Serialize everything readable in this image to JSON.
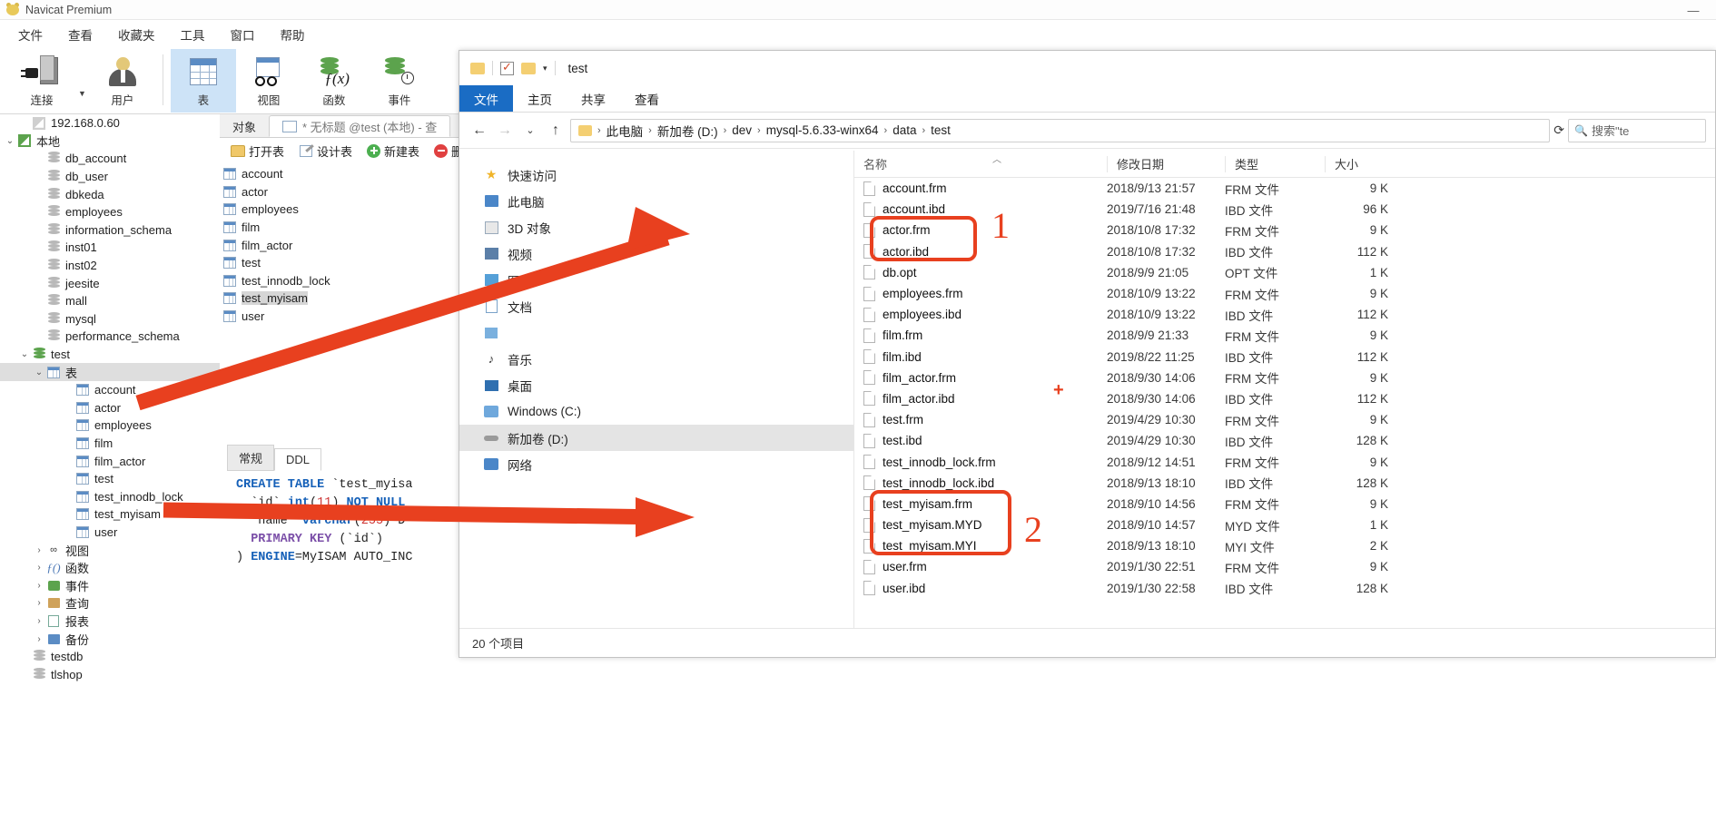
{
  "app": {
    "title": "Navicat Premium",
    "minimize_label": "—",
    "menu": [
      "文件",
      "查看",
      "收藏夹",
      "工具",
      "窗口",
      "帮助"
    ],
    "ribbon": [
      {
        "label": "连接",
        "icon": "connection-icon"
      },
      {
        "label": "用户",
        "icon": "user-icon"
      },
      {
        "label": "表",
        "icon": "table-icon",
        "active": true
      },
      {
        "label": "视图",
        "icon": "view-icon"
      },
      {
        "label": "函数",
        "icon": "function-icon"
      },
      {
        "label": "事件",
        "icon": "event-icon"
      }
    ]
  },
  "sidebar": {
    "items": [
      {
        "label": "192.168.0.60",
        "icon": "connection-gray-icon",
        "indent": 1,
        "twisty": "",
        "selected": false
      },
      {
        "label": "本地",
        "icon": "connection-green-icon",
        "indent": 0,
        "twisty": "v",
        "selected": false
      },
      {
        "label": "db_account",
        "icon": "database-icon",
        "indent": 2,
        "twisty": "",
        "selected": false
      },
      {
        "label": "db_user",
        "icon": "database-icon",
        "indent": 2,
        "twisty": "",
        "selected": false
      },
      {
        "label": "dbkeda",
        "icon": "database-icon",
        "indent": 2,
        "twisty": "",
        "selected": false
      },
      {
        "label": "employees",
        "icon": "database-icon",
        "indent": 2,
        "twisty": "",
        "selected": false
      },
      {
        "label": "information_schema",
        "icon": "database-icon",
        "indent": 2,
        "twisty": "",
        "selected": false
      },
      {
        "label": "inst01",
        "icon": "database-icon",
        "indent": 2,
        "twisty": "",
        "selected": false
      },
      {
        "label": "inst02",
        "icon": "database-icon",
        "indent": 2,
        "twisty": "",
        "selected": false
      },
      {
        "label": "jeesite",
        "icon": "database-icon",
        "indent": 2,
        "twisty": "",
        "selected": false
      },
      {
        "label": "mall",
        "icon": "database-icon",
        "indent": 2,
        "twisty": "",
        "selected": false
      },
      {
        "label": "mysql",
        "icon": "database-icon",
        "indent": 2,
        "twisty": "",
        "selected": false
      },
      {
        "label": "performance_schema",
        "icon": "database-icon",
        "indent": 2,
        "twisty": "",
        "selected": false
      },
      {
        "label": "test",
        "icon": "database-green-icon",
        "indent": 1,
        "twisty": "v",
        "selected": false
      },
      {
        "label": "表",
        "icon": "table-icon",
        "indent": 2,
        "twisty": "v",
        "selected": true
      },
      {
        "label": "account",
        "icon": "table-icon",
        "indent": 4,
        "twisty": "",
        "selected": false
      },
      {
        "label": "actor",
        "icon": "table-icon",
        "indent": 4,
        "twisty": "",
        "selected": false
      },
      {
        "label": "employees",
        "icon": "table-icon",
        "indent": 4,
        "twisty": "",
        "selected": false
      },
      {
        "label": "film",
        "icon": "table-icon",
        "indent": 4,
        "twisty": "",
        "selected": false
      },
      {
        "label": "film_actor",
        "icon": "table-icon",
        "indent": 4,
        "twisty": "",
        "selected": false
      },
      {
        "label": "test",
        "icon": "table-icon",
        "indent": 4,
        "twisty": "",
        "selected": false
      },
      {
        "label": "test_innodb_lock",
        "icon": "table-icon",
        "indent": 4,
        "twisty": "",
        "selected": false
      },
      {
        "label": "test_myisam",
        "icon": "table-icon",
        "indent": 4,
        "twisty": "",
        "selected": false
      },
      {
        "label": "user",
        "icon": "table-icon",
        "indent": 4,
        "twisty": "",
        "selected": false
      },
      {
        "label": "视图",
        "icon": "view-icon",
        "indent": 2,
        "twisty": ">",
        "selected": false
      },
      {
        "label": "函数",
        "icon": "function-icon",
        "indent": 2,
        "twisty": ">",
        "selected": false
      },
      {
        "label": "事件",
        "icon": "event-icon",
        "indent": 2,
        "twisty": ">",
        "selected": false
      },
      {
        "label": "查询",
        "icon": "query-icon",
        "indent": 2,
        "twisty": ">",
        "selected": false
      },
      {
        "label": "报表",
        "icon": "report-icon",
        "indent": 2,
        "twisty": ">",
        "selected": false
      },
      {
        "label": "备份",
        "icon": "backup-icon",
        "indent": 2,
        "twisty": ">",
        "selected": false
      },
      {
        "label": "testdb",
        "icon": "database-icon",
        "indent": 1,
        "twisty": "",
        "selected": false
      },
      {
        "label": "tlshop",
        "icon": "database-icon",
        "indent": 1,
        "twisty": "",
        "selected": false
      }
    ]
  },
  "main": {
    "tabs": [
      {
        "label": "对象",
        "active": false
      },
      {
        "label": "* 无标题 @test (本地) - 查",
        "active": true
      }
    ],
    "toolbar": [
      {
        "label": "打开表",
        "icon": "open-table-icon"
      },
      {
        "label": "设计表",
        "icon": "design-table-icon"
      },
      {
        "label": "新建表",
        "icon": "new-table-icon"
      },
      {
        "label": "删除",
        "icon": "delete-table-icon"
      }
    ],
    "objects": [
      {
        "label": "account",
        "selected": false
      },
      {
        "label": "actor",
        "selected": false
      },
      {
        "label": "employees",
        "selected": false
      },
      {
        "label": "film",
        "selected": false
      },
      {
        "label": "film_actor",
        "selected": false
      },
      {
        "label": "test",
        "selected": false
      },
      {
        "label": "test_innodb_lock",
        "selected": false
      },
      {
        "label": "test_myisam",
        "selected": true
      },
      {
        "label": "user",
        "selected": false
      }
    ],
    "ddl": {
      "tabs": [
        {
          "label": "常规",
          "active": false
        },
        {
          "label": "DDL",
          "active": true
        }
      ],
      "lines": [
        [
          {
            "t": "CREATE",
            "c": "kw"
          },
          {
            "t": " ",
            "c": ""
          },
          {
            "t": "TABLE",
            "c": "kw"
          },
          {
            "t": " `test_myisa",
            "c": "ident"
          }
        ],
        [
          {
            "t": "  `id` ",
            "c": "ident"
          },
          {
            "t": "int",
            "c": "kw"
          },
          {
            "t": "(",
            "c": "ident"
          },
          {
            "t": "11",
            "c": "num"
          },
          {
            "t": ") ",
            "c": "ident"
          },
          {
            "t": "NOT NULL",
            "c": "kw"
          }
        ],
        [
          {
            "t": "  `name` ",
            "c": "ident"
          },
          {
            "t": "varchar",
            "c": "kw"
          },
          {
            "t": "(",
            "c": "ident"
          },
          {
            "t": "255",
            "c": "num"
          },
          {
            "t": ") D",
            "c": "ident"
          }
        ],
        [
          {
            "t": "  PRIMARY KEY",
            "c": "kwp"
          },
          {
            "t": " (`id`)",
            "c": "ident"
          }
        ],
        [
          {
            "t": ") ",
            "c": "ident"
          },
          {
            "t": "ENGINE",
            "c": "kw"
          },
          {
            "t": "=MyISAM AUTO_INC",
            "c": "ident"
          }
        ]
      ]
    }
  },
  "explorer": {
    "titlebar": {
      "title": "test",
      "quick_access_icons": [
        "folder-icon",
        "properties-checkbox-icon",
        "new-folder-icon",
        "customize-chevron-icon"
      ]
    },
    "ribbon_tabs": [
      {
        "label": "文件",
        "active": true
      },
      {
        "label": "主页",
        "active": false
      },
      {
        "label": "共享",
        "active": false
      },
      {
        "label": "查看",
        "active": false
      }
    ],
    "address": {
      "back_icon": "arrow-left-icon",
      "forward_icon": "arrow-right-icon",
      "history_icon": "chevron-down-icon",
      "up_icon": "arrow-up-icon",
      "breadcrumbs": [
        "此电脑",
        "新加卷 (D:)",
        "dev",
        "mysql-5.6.33-winx64",
        "data",
        "test"
      ],
      "refresh_icon": "refresh-icon",
      "search_placeholder": "搜索\"te"
    },
    "nav_pane": [
      {
        "label": "快速访问",
        "icon": "star-icon",
        "selected": false
      },
      {
        "label": "此电脑",
        "icon": "pc-icon",
        "selected": false
      },
      {
        "label": "3D 对象",
        "icon": "3d-object-icon",
        "selected": false
      },
      {
        "label": "视频",
        "icon": "video-icon",
        "selected": false
      },
      {
        "label": "图片",
        "icon": "picture-icon",
        "selected": false
      },
      {
        "label": "文档",
        "icon": "document-icon",
        "selected": false
      },
      {
        "label": "",
        "icon": "download-icon",
        "selected": false
      },
      {
        "label": "音乐",
        "icon": "music-icon",
        "selected": false
      },
      {
        "label": "桌面",
        "icon": "desktop-icon",
        "selected": false
      },
      {
        "label": "Windows (C:)",
        "icon": "drive-icon",
        "selected": false
      },
      {
        "label": "新加卷 (D:)",
        "icon": "drive-icon",
        "selected": true
      },
      {
        "label": "网络",
        "icon": "network-icon",
        "selected": false
      }
    ],
    "columns": [
      "名称",
      "修改日期",
      "类型",
      "大小"
    ],
    "files": [
      {
        "name": "account.frm",
        "date": "2018/9/13 21:57",
        "type": "FRM 文件",
        "size": "9 K"
      },
      {
        "name": "account.ibd",
        "date": "2019/7/16 21:48",
        "type": "IBD 文件",
        "size": "96 K"
      },
      {
        "name": "actor.frm",
        "date": "2018/10/8 17:32",
        "type": "FRM 文件",
        "size": "9 K"
      },
      {
        "name": "actor.ibd",
        "date": "2018/10/8 17:32",
        "type": "IBD 文件",
        "size": "112 K"
      },
      {
        "name": "db.opt",
        "date": "2018/9/9 21:05",
        "type": "OPT 文件",
        "size": "1 K"
      },
      {
        "name": "employees.frm",
        "date": "2018/10/9 13:22",
        "type": "FRM 文件",
        "size": "9 K"
      },
      {
        "name": "employees.ibd",
        "date": "2018/10/9 13:22",
        "type": "IBD 文件",
        "size": "112 K"
      },
      {
        "name": "film.frm",
        "date": "2018/9/9 21:33",
        "type": "FRM 文件",
        "size": "9 K"
      },
      {
        "name": "film.ibd",
        "date": "2019/8/22 11:25",
        "type": "IBD 文件",
        "size": "112 K"
      },
      {
        "name": "film_actor.frm",
        "date": "2018/9/30 14:06",
        "type": "FRM 文件",
        "size": "9 K"
      },
      {
        "name": "film_actor.ibd",
        "date": "2018/9/30 14:06",
        "type": "IBD 文件",
        "size": "112 K"
      },
      {
        "name": "test.frm",
        "date": "2019/4/29 10:30",
        "type": "FRM 文件",
        "size": "9 K"
      },
      {
        "name": "test.ibd",
        "date": "2019/4/29 10:30",
        "type": "IBD 文件",
        "size": "128 K"
      },
      {
        "name": "test_innodb_lock.frm",
        "date": "2018/9/12 14:51",
        "type": "FRM 文件",
        "size": "9 K"
      },
      {
        "name": "test_innodb_lock.ibd",
        "date": "2018/9/13 18:10",
        "type": "IBD 文件",
        "size": "128 K"
      },
      {
        "name": "test_myisam.frm",
        "date": "2018/9/10 14:56",
        "type": "FRM 文件",
        "size": "9 K"
      },
      {
        "name": "test_myisam.MYD",
        "date": "2018/9/10 14:57",
        "type": "MYD 文件",
        "size": "1 K"
      },
      {
        "name": "test_myisam.MYI",
        "date": "2018/9/13 18:10",
        "type": "MYI 文件",
        "size": "2 K"
      },
      {
        "name": "user.frm",
        "date": "2019/1/30 22:51",
        "type": "FRM 文件",
        "size": "9 K"
      },
      {
        "name": "user.ibd",
        "date": "2019/1/30 22:58",
        "type": "IBD 文件",
        "size": "128 K"
      }
    ],
    "status": "20 个项目"
  },
  "annotations": {
    "color": "#e8401f",
    "marks": [
      {
        "label": "1",
        "kind": "callout-number"
      },
      {
        "label": "2",
        "kind": "callout-number"
      },
      {
        "label": "+",
        "kind": "plus-mark"
      }
    ]
  }
}
